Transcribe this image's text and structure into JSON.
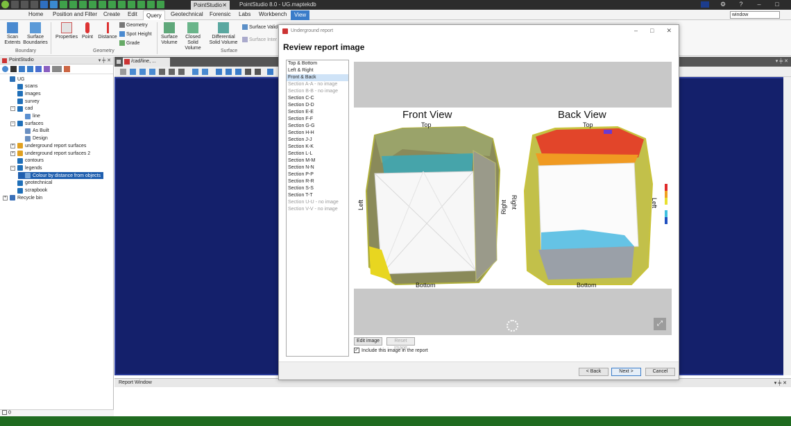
{
  "titlebar": {
    "app_tab": "PointStudio",
    "window_title": "PointStudio 8.0 - UG.maptekdb",
    "close_glyph": "✕"
  },
  "ribbon_tabs": [
    "Home",
    "Position and Filter",
    "Create",
    "Edit",
    "Query",
    "Geotechnical",
    "Forensic",
    "Labs",
    "Workbench",
    "View"
  ],
  "active_tab": "Query",
  "search": {
    "value": "window"
  },
  "ribbon": {
    "boundary": {
      "label": "Boundary",
      "scan_extents": "Scan Extents",
      "surface_boundaries": "Surface Boundaries"
    },
    "geometry": {
      "label": "Geometry",
      "properties": "Properties",
      "point": "Point",
      "distance": "Distance",
      "geometry": "Geometry",
      "spot_height": "Spot Height",
      "grade": "Grade"
    },
    "surface": {
      "label": "Surface",
      "surface_volume": "Surface Volume",
      "closed_solid_volume": "Closed Solid Volume",
      "differential_solid_volume": "Differential Solid Volume",
      "surface_validity": "Surface Valid",
      "surface_intersect": "Surface Inter"
    }
  },
  "left_panel": {
    "title": "PointStudio",
    "tree": [
      {
        "label": "UG",
        "level": 0,
        "expander": "",
        "icon": "database",
        "color": "#2b6fb5"
      },
      {
        "label": "scans",
        "level": 1,
        "expander": "",
        "icon": "container",
        "color": "#1f6fb8"
      },
      {
        "label": "images",
        "level": 1,
        "expander": "",
        "icon": "container",
        "color": "#1f6fb8"
      },
      {
        "label": "survey",
        "level": 1,
        "expander": "",
        "icon": "container",
        "color": "#1f6fb8"
      },
      {
        "label": "cad",
        "level": 1,
        "expander": "−",
        "icon": "container",
        "color": "#1f6fb8"
      },
      {
        "label": "line",
        "level": 2,
        "expander": "",
        "icon": "polyline",
        "color": "#5a8fd0"
      },
      {
        "label": "surfaces",
        "level": 1,
        "expander": "−",
        "icon": "container",
        "color": "#1f6fb8"
      },
      {
        "label": "As Built",
        "level": 2,
        "expander": "",
        "icon": "surface",
        "color": "#6a8fc0"
      },
      {
        "label": "Design",
        "level": 2,
        "expander": "",
        "icon": "surface",
        "color": "#6a8fc0"
      },
      {
        "label": "underground report surfaces",
        "level": 1,
        "expander": "+",
        "icon": "folder",
        "color": "#e0a020"
      },
      {
        "label": "underground report surfaces 2",
        "level": 1,
        "expander": "+",
        "icon": "folder",
        "color": "#e0a020"
      },
      {
        "label": "contours",
        "level": 1,
        "expander": "",
        "icon": "container",
        "color": "#1f6fb8"
      },
      {
        "label": "legends",
        "level": 1,
        "expander": "−",
        "icon": "container",
        "color": "#1f6fb8"
      },
      {
        "label": "Colour by distance from objects",
        "level": 2,
        "expander": "",
        "icon": "legend",
        "color": "#7aa7d8",
        "selected": true
      },
      {
        "label": "geotechnical",
        "level": 1,
        "expander": "",
        "icon": "container",
        "color": "#1f6fb8"
      },
      {
        "label": "scrapbook",
        "level": 1,
        "expander": "",
        "icon": "container",
        "color": "#1f6fb8"
      },
      {
        "label": "Recycle bin",
        "level": 0,
        "expander": "+",
        "icon": "recycle",
        "color": "#3a6fb8"
      }
    ],
    "status_value": "0"
  },
  "view": {
    "tab_label": "/cad/line, ..."
  },
  "report_window": {
    "title": "Report Window"
  },
  "dialog": {
    "title": "Underground report",
    "heading": "Review report image",
    "list": [
      {
        "label": "Top & Bottom",
        "state": "normal"
      },
      {
        "label": "Left & Right",
        "state": "normal"
      },
      {
        "label": "Front & Back",
        "state": "selected"
      },
      {
        "label": "Section A-A - no image",
        "state": "disabled"
      },
      {
        "label": "Section B-B - no image",
        "state": "disabled"
      },
      {
        "label": "Section C-C",
        "state": "normal"
      },
      {
        "label": "Section D-D",
        "state": "normal"
      },
      {
        "label": "Section E-E",
        "state": "normal"
      },
      {
        "label": "Section F-F",
        "state": "normal"
      },
      {
        "label": "Section G-G",
        "state": "normal"
      },
      {
        "label": "Section H-H",
        "state": "normal"
      },
      {
        "label": "Section J-J",
        "state": "normal"
      },
      {
        "label": "Section K-K",
        "state": "normal"
      },
      {
        "label": "Section L-L",
        "state": "normal"
      },
      {
        "label": "Section M-M",
        "state": "normal"
      },
      {
        "label": "Section N-N",
        "state": "normal"
      },
      {
        "label": "Section P-P",
        "state": "normal"
      },
      {
        "label": "Section R-R",
        "state": "normal"
      },
      {
        "label": "Section S-S",
        "state": "normal"
      },
      {
        "label": "Section T-T",
        "state": "normal"
      },
      {
        "label": "Section U-U - no image",
        "state": "disabled"
      },
      {
        "label": "Section V-V - no image",
        "state": "disabled"
      }
    ],
    "preview": {
      "front_title": "Front View",
      "back_title": "Back View",
      "top": "Top",
      "bottom": "Bottom",
      "left": "Left",
      "right": "Right"
    },
    "edit_image": "Edit image",
    "reset_image": "Reset image",
    "include_label": "Include this image in the report",
    "include_checked": true,
    "back": "< Back",
    "next": "Next >",
    "cancel": "Cancel"
  },
  "colors": {
    "accent": "#3a7cc9",
    "viewport_bg": "#14206b",
    "selected_bg": "#1f5faf",
    "status_green": "#1f6b20"
  }
}
